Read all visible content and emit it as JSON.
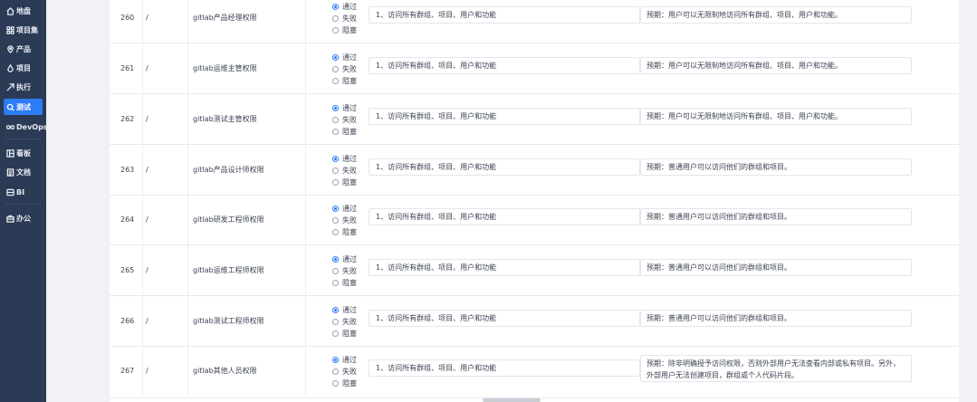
{
  "sidebar": {
    "items": [
      {
        "label": "地盘",
        "icon": "home-icon"
      },
      {
        "label": "项目集",
        "icon": "grid-icon"
      },
      {
        "label": "产品",
        "icon": "location-icon"
      },
      {
        "label": "项目",
        "icon": "drop-icon"
      },
      {
        "label": "执行",
        "icon": "send-icon"
      },
      {
        "label": "测试",
        "icon": "search-icon",
        "active": true
      },
      {
        "label": "DevOps",
        "icon": "infinity-icon"
      },
      {
        "label": "看板",
        "icon": "kanban-icon"
      },
      {
        "label": "文档",
        "icon": "doc-icon"
      },
      {
        "label": "BI",
        "icon": "database-icon"
      },
      {
        "label": "办公",
        "icon": "briefcase-icon"
      }
    ]
  },
  "radio_options": [
    "通过",
    "失败",
    "阻塞"
  ],
  "rows": [
    {
      "id": "260",
      "sep": "/",
      "name": "gitlab产品经理权限",
      "step": "1、访问所有群组、项目、用户和功能",
      "expect": "预期：用户可以无限制地访问所有群组、项目、用户和功能。",
      "selected": 0
    },
    {
      "id": "261",
      "sep": "/",
      "name": "gitlab运维主管权限",
      "step": "1、访问所有群组、项目、用户和功能",
      "expect": "预期：用户可以无限制地访问所有群组、项目、用户和功能。",
      "selected": 0
    },
    {
      "id": "262",
      "sep": "/",
      "name": "gitlab测试主管权限",
      "step": "1、访问所有群组、项目、用户和功能",
      "expect": "预期：用户可以无限制地访问所有群组、项目、用户和功能。",
      "selected": 0
    },
    {
      "id": "263",
      "sep": "/",
      "name": "gitlab产品设计师权限",
      "step": "1、访问所有群组、项目、用户和功能",
      "expect": "预期：普通用户可以访问他们的群组和项目。",
      "selected": 0
    },
    {
      "id": "264",
      "sep": "/",
      "name": "gitlab研发工程师权限",
      "step": "1、访问所有群组、项目、用户和功能",
      "expect": "预期：普通用户可以访问他们的群组和项目。",
      "selected": 0
    },
    {
      "id": "265",
      "sep": "/",
      "name": "gitlab运维工程师权限",
      "step": "1、访问所有群组、项目、用户和功能",
      "expect": "预期：普通用户可以访问他们的群组和项目。",
      "selected": 0
    },
    {
      "id": "266",
      "sep": "/",
      "name": "gitlab测试工程师权限",
      "step": "1、访问所有群组、项目、用户和功能",
      "expect": "预期：普通用户可以访问他们的群组和项目。",
      "selected": 0
    },
    {
      "id": "267",
      "sep": "/",
      "name": "gitlab其他人员权限",
      "step": "1、访问所有群组、项目、用户和功能",
      "expect": "预期：除非明确授予访问权限，否则外部用户无法查看内部或私有项目。另外，外部用户无法创建项目，群组或个人代码片段。",
      "selected": 0
    }
  ],
  "colors": {
    "sidebar_bg": "#2b3a55",
    "active": "#2e7cf6",
    "page_bg": "#f0f2f5"
  }
}
